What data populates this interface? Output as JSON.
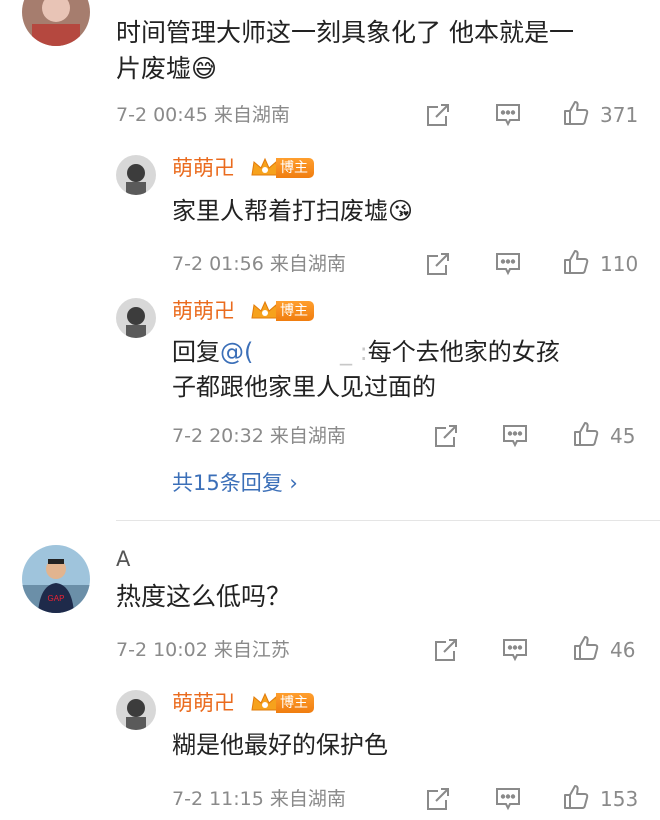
{
  "comments": [
    {
      "text_line1": "时间管理大师这一刻具象化了 他本就是一",
      "text_line2": "片废墟",
      "emoji": "😅",
      "time": "7-2 00:45",
      "location": "来自湖南",
      "likes": "371",
      "replies": [
        {
          "author": "萌萌卍",
          "badge": "博主",
          "text": "家里人帮着打扫废墟",
          "emoji": "😘",
          "time": "7-2 01:56",
          "location": "来自湖南",
          "likes": "110"
        },
        {
          "author": "萌萌卍",
          "badge": "博主",
          "reply_prefix": "回复",
          "mention": "@(",
          "mention_tail": "_ :",
          "text_line1": "每个去他家的女孩",
          "text_line2": "子都跟他家里人见过面的",
          "time": "7-2 20:32",
          "location": "来自湖南",
          "likes": "45"
        }
      ],
      "more_replies": "共15条回复",
      "more_chevron": "›"
    },
    {
      "author": "A",
      "text": "热度这么低吗？",
      "time": "7-2 10:02",
      "location": "来自江苏",
      "likes": "46",
      "replies": [
        {
          "author": "萌萌卍",
          "badge": "博主",
          "text": "糊是他最好的保护色",
          "time": "7-2 11:15",
          "location": "来自湖南",
          "likes": "153"
        }
      ]
    }
  ],
  "icons": {
    "share": "share-icon",
    "comment": "comment-icon",
    "like": "thumbs-up-icon"
  },
  "colors": {
    "accent_name": "#ea6b1e",
    "link": "#3b6fb8",
    "meta": "#8a8a8a",
    "badge": "#f07d10"
  }
}
